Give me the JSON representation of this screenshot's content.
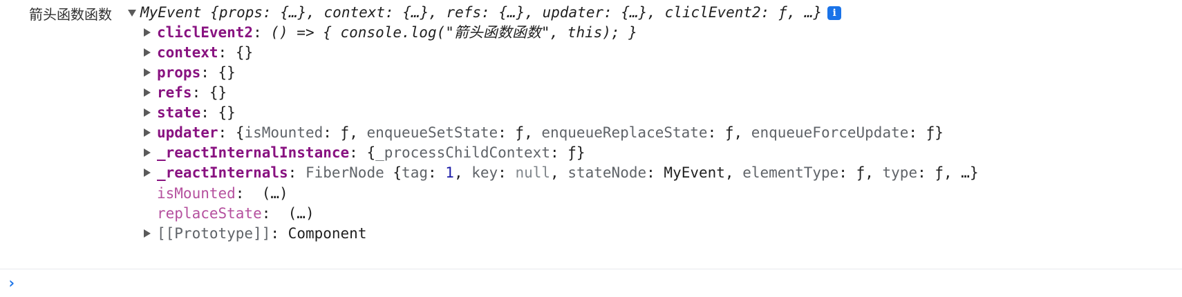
{
  "console": {
    "log_label": "箭头函数函数",
    "summary": {
      "class_name": "MyEvent",
      "preview": "{props: {…}, context: {…}, refs: {…}, updater: {…}, cliclEvent2: ƒ, …}"
    },
    "props": {
      "cliclEvent2": {
        "key": "cliclEvent2",
        "sep": ": ",
        "value": "() => { console.log(\"箭头函数函数\", this); }"
      },
      "context": {
        "key": "context",
        "sep": ": ",
        "value": "{}"
      },
      "props": {
        "key": "props",
        "sep": ": ",
        "value": "{}"
      },
      "refs": {
        "key": "refs",
        "sep": ": ",
        "value": "{}"
      },
      "state": {
        "key": "state",
        "sep": ": ",
        "value": "{}"
      },
      "updater": {
        "key": "updater",
        "sep": ": ",
        "open": "{",
        "k1": "isMounted",
        "v1": ": ƒ, ",
        "k2": "enqueueSetState",
        "v2": ": ƒ, ",
        "k3": "enqueueReplaceState",
        "v3": ": ƒ, ",
        "k4": "enqueueForceUpdate",
        "v4": ": ƒ}"
      },
      "reactInternalInstance": {
        "key": "_reactInternalInstance",
        "sep": ": ",
        "open": "{",
        "k1": "_processChildContext",
        "v1": ": ƒ}"
      },
      "reactInternals": {
        "key": "_reactInternals",
        "sep": ": ",
        "type": "FiberNode",
        "open": " {",
        "k_tag": "tag",
        "c1": ": ",
        "tag": "1",
        "c2": ", ",
        "k_key": "key",
        "c3": ": ",
        "key_val": "null",
        "c4": ", ",
        "k_sn": "stateNode",
        "v_sn": ": MyEvent, ",
        "k_et": "elementType",
        "v_et": ": ƒ, ",
        "k_type": "type",
        "v_type": ": ƒ, …}"
      },
      "isMounted": {
        "key": "isMounted",
        "sep": ":  ",
        "value": "(…)"
      },
      "replaceState": {
        "key": "replaceState",
        "sep": ":  ",
        "value": "(…)"
      },
      "prototype": {
        "key": "[[Prototype]]",
        "sep": ": ",
        "value": "Component"
      }
    },
    "info_icon": "i",
    "prompt_icon": "›"
  },
  "colors": {
    "key": "#881280",
    "key_dim": "#b5509e",
    "number": "#1a1aa6",
    "null": "#80868b",
    "info": "#1a73e8"
  }
}
